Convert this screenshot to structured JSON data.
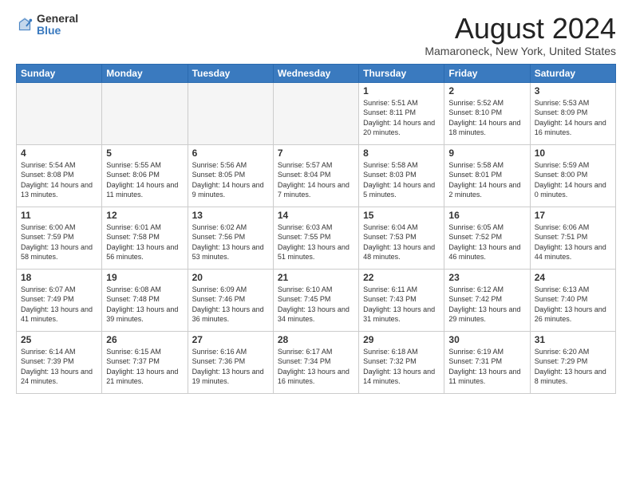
{
  "header": {
    "logo": {
      "general": "General",
      "blue": "Blue"
    },
    "title": "August 2024",
    "subtitle": "Mamaroneck, New York, United States"
  },
  "weekdays": [
    "Sunday",
    "Monday",
    "Tuesday",
    "Wednesday",
    "Thursday",
    "Friday",
    "Saturday"
  ],
  "weeks": [
    {
      "days": [
        {
          "num": "",
          "empty": true
        },
        {
          "num": "",
          "empty": true
        },
        {
          "num": "",
          "empty": true
        },
        {
          "num": "",
          "empty": true
        },
        {
          "num": "1",
          "sunrise": "5:51 AM",
          "sunset": "8:11 PM",
          "daylight": "14 hours and 20 minutes."
        },
        {
          "num": "2",
          "sunrise": "5:52 AM",
          "sunset": "8:10 PM",
          "daylight": "14 hours and 18 minutes."
        },
        {
          "num": "3",
          "sunrise": "5:53 AM",
          "sunset": "8:09 PM",
          "daylight": "14 hours and 16 minutes."
        }
      ]
    },
    {
      "days": [
        {
          "num": "4",
          "sunrise": "5:54 AM",
          "sunset": "8:08 PM",
          "daylight": "14 hours and 13 minutes."
        },
        {
          "num": "5",
          "sunrise": "5:55 AM",
          "sunset": "8:06 PM",
          "daylight": "14 hours and 11 minutes."
        },
        {
          "num": "6",
          "sunrise": "5:56 AM",
          "sunset": "8:05 PM",
          "daylight": "14 hours and 9 minutes."
        },
        {
          "num": "7",
          "sunrise": "5:57 AM",
          "sunset": "8:04 PM",
          "daylight": "14 hours and 7 minutes."
        },
        {
          "num": "8",
          "sunrise": "5:58 AM",
          "sunset": "8:03 PM",
          "daylight": "14 hours and 5 minutes."
        },
        {
          "num": "9",
          "sunrise": "5:58 AM",
          "sunset": "8:01 PM",
          "daylight": "14 hours and 2 minutes."
        },
        {
          "num": "10",
          "sunrise": "5:59 AM",
          "sunset": "8:00 PM",
          "daylight": "14 hours and 0 minutes."
        }
      ]
    },
    {
      "days": [
        {
          "num": "11",
          "sunrise": "6:00 AM",
          "sunset": "7:59 PM",
          "daylight": "13 hours and 58 minutes."
        },
        {
          "num": "12",
          "sunrise": "6:01 AM",
          "sunset": "7:58 PM",
          "daylight": "13 hours and 56 minutes."
        },
        {
          "num": "13",
          "sunrise": "6:02 AM",
          "sunset": "7:56 PM",
          "daylight": "13 hours and 53 minutes."
        },
        {
          "num": "14",
          "sunrise": "6:03 AM",
          "sunset": "7:55 PM",
          "daylight": "13 hours and 51 minutes."
        },
        {
          "num": "15",
          "sunrise": "6:04 AM",
          "sunset": "7:53 PM",
          "daylight": "13 hours and 48 minutes."
        },
        {
          "num": "16",
          "sunrise": "6:05 AM",
          "sunset": "7:52 PM",
          "daylight": "13 hours and 46 minutes."
        },
        {
          "num": "17",
          "sunrise": "6:06 AM",
          "sunset": "7:51 PM",
          "daylight": "13 hours and 44 minutes."
        }
      ]
    },
    {
      "days": [
        {
          "num": "18",
          "sunrise": "6:07 AM",
          "sunset": "7:49 PM",
          "daylight": "13 hours and 41 minutes."
        },
        {
          "num": "19",
          "sunrise": "6:08 AM",
          "sunset": "7:48 PM",
          "daylight": "13 hours and 39 minutes."
        },
        {
          "num": "20",
          "sunrise": "6:09 AM",
          "sunset": "7:46 PM",
          "daylight": "13 hours and 36 minutes."
        },
        {
          "num": "21",
          "sunrise": "6:10 AM",
          "sunset": "7:45 PM",
          "daylight": "13 hours and 34 minutes."
        },
        {
          "num": "22",
          "sunrise": "6:11 AM",
          "sunset": "7:43 PM",
          "daylight": "13 hours and 31 minutes."
        },
        {
          "num": "23",
          "sunrise": "6:12 AM",
          "sunset": "7:42 PM",
          "daylight": "13 hours and 29 minutes."
        },
        {
          "num": "24",
          "sunrise": "6:13 AM",
          "sunset": "7:40 PM",
          "daylight": "13 hours and 26 minutes."
        }
      ]
    },
    {
      "days": [
        {
          "num": "25",
          "sunrise": "6:14 AM",
          "sunset": "7:39 PM",
          "daylight": "13 hours and 24 minutes."
        },
        {
          "num": "26",
          "sunrise": "6:15 AM",
          "sunset": "7:37 PM",
          "daylight": "13 hours and 21 minutes."
        },
        {
          "num": "27",
          "sunrise": "6:16 AM",
          "sunset": "7:36 PM",
          "daylight": "13 hours and 19 minutes."
        },
        {
          "num": "28",
          "sunrise": "6:17 AM",
          "sunset": "7:34 PM",
          "daylight": "13 hours and 16 minutes."
        },
        {
          "num": "29",
          "sunrise": "6:18 AM",
          "sunset": "7:32 PM",
          "daylight": "13 hours and 14 minutes."
        },
        {
          "num": "30",
          "sunrise": "6:19 AM",
          "sunset": "7:31 PM",
          "daylight": "13 hours and 11 minutes."
        },
        {
          "num": "31",
          "sunrise": "6:20 AM",
          "sunset": "7:29 PM",
          "daylight": "13 hours and 8 minutes."
        }
      ]
    }
  ],
  "labels": {
    "sunrise": "Sunrise:",
    "sunset": "Sunset:",
    "daylight": "Daylight:"
  }
}
